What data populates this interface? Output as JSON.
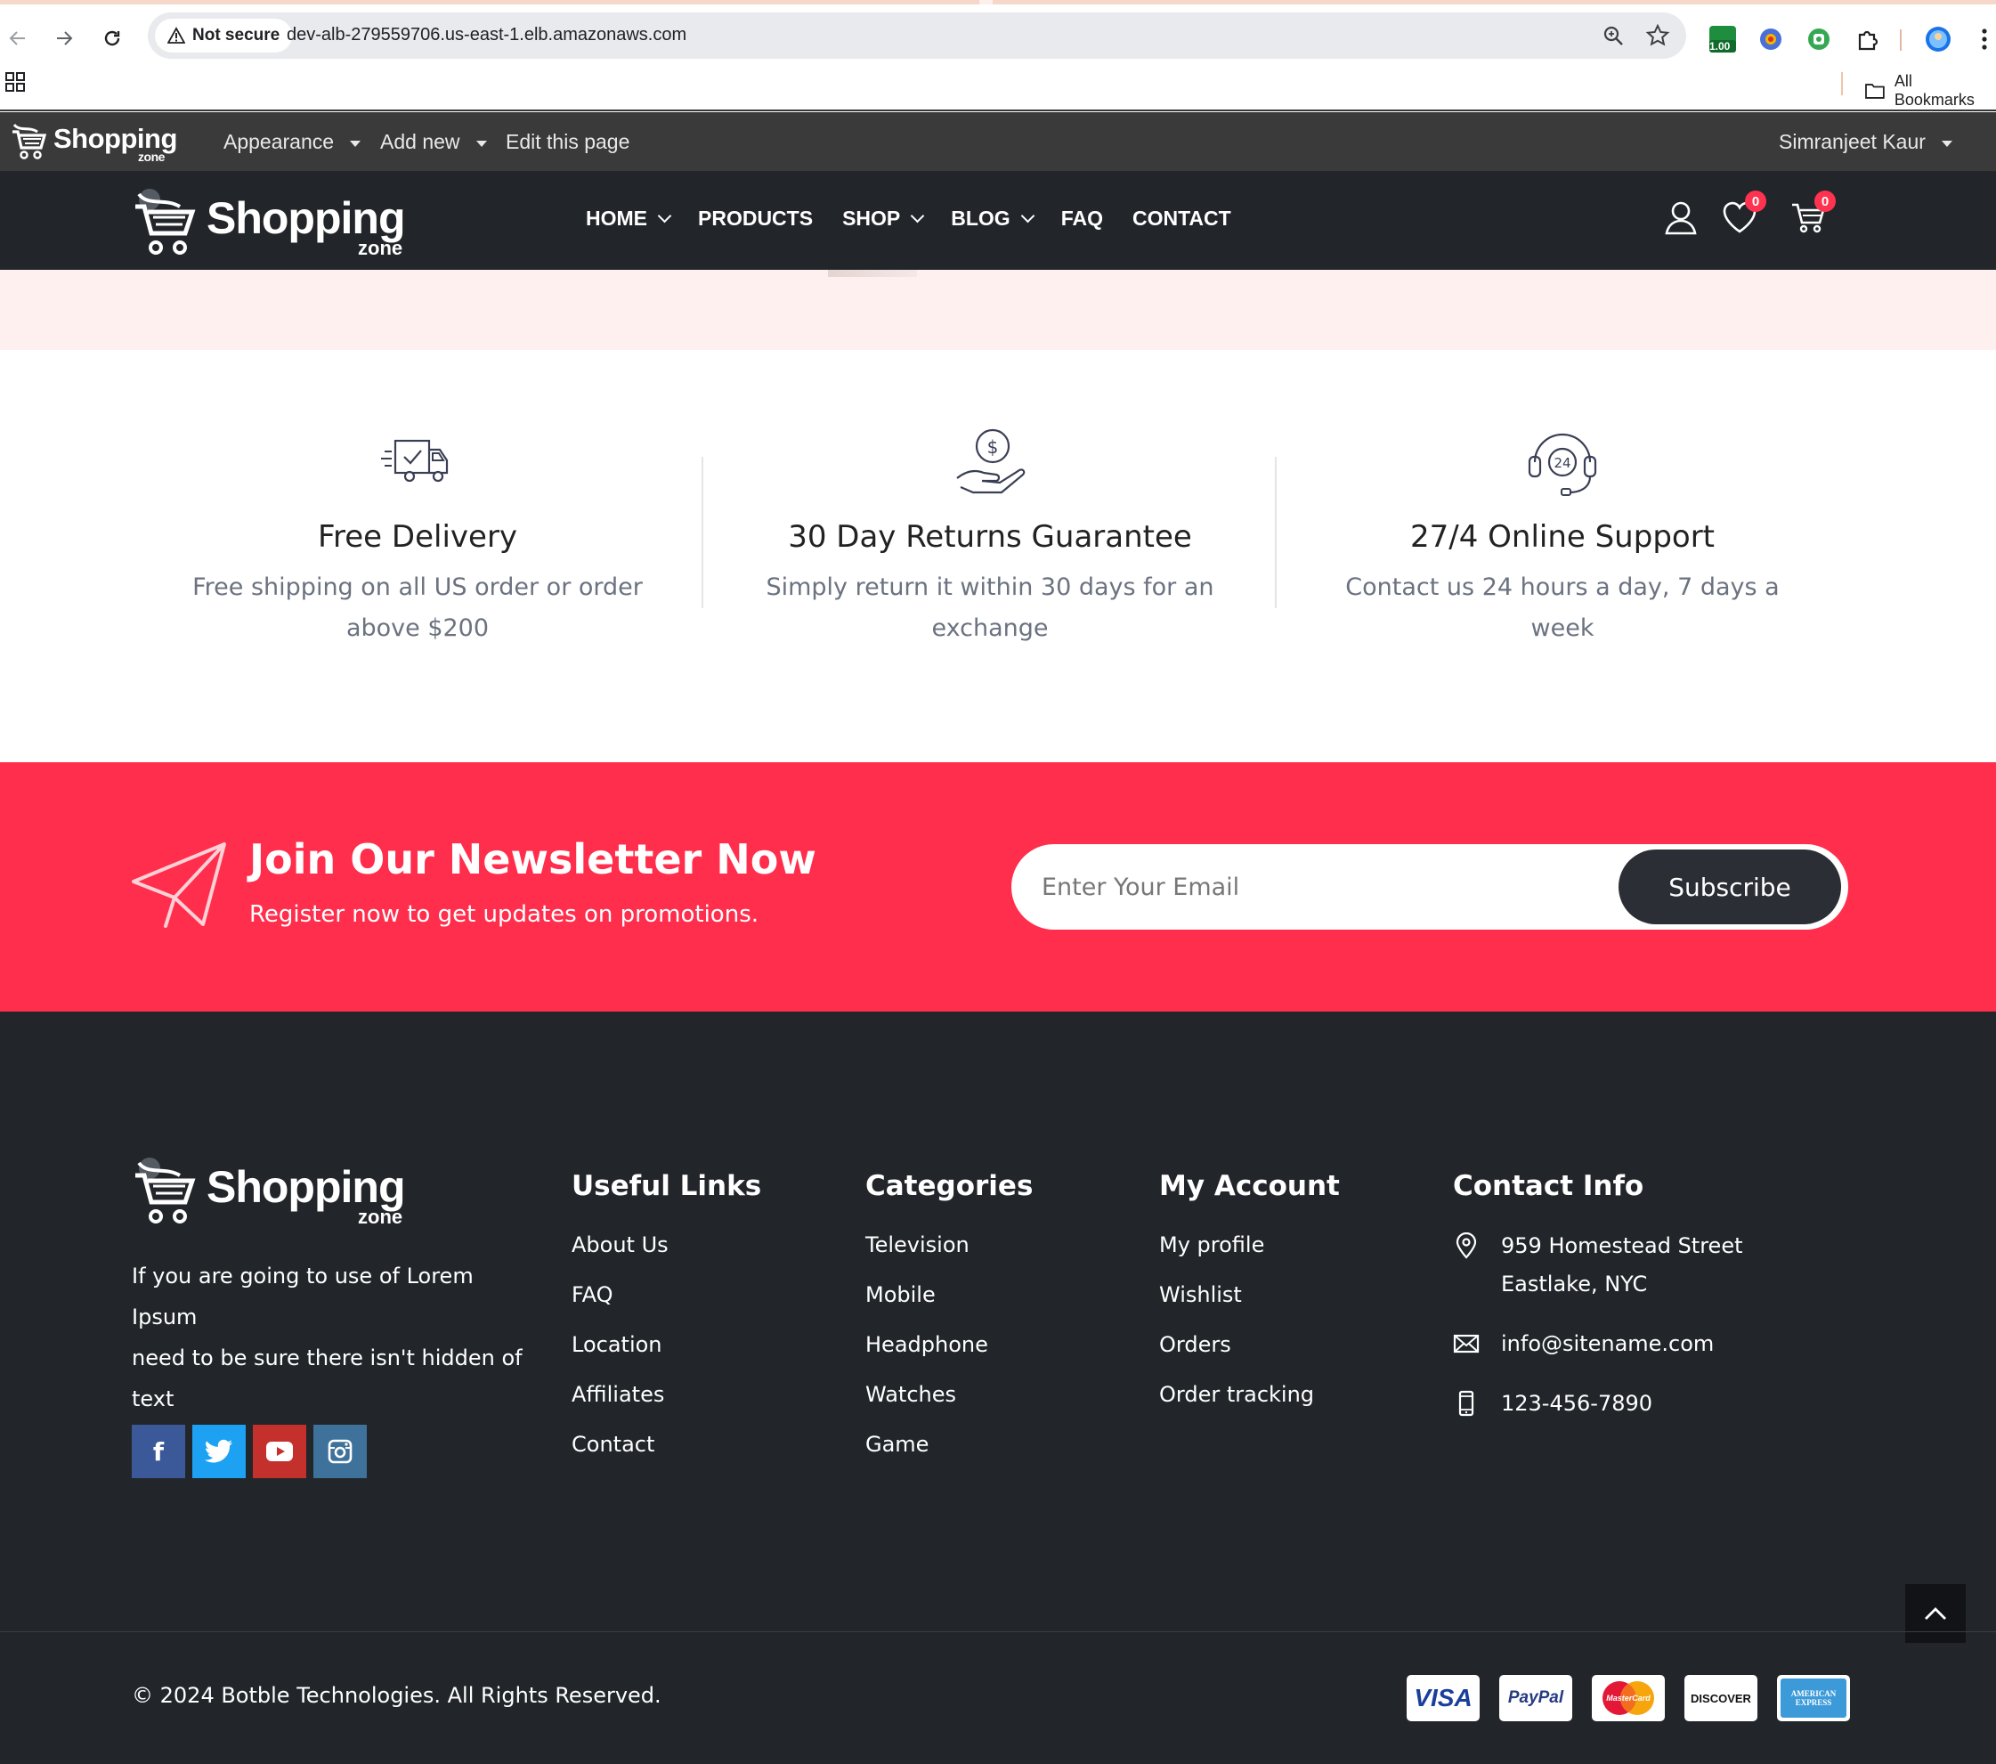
{
  "browser": {
    "security_label": "Not secure",
    "url": "dev-alb-279559706.us-east-1.elb.amazonaws.com",
    "extension_badge": "1.00",
    "bookmarks_label": "All Bookmarks"
  },
  "admin_bar": {
    "logo_text": "Shopping",
    "logo_sub": "zone",
    "menu": [
      {
        "label": "Appearance"
      },
      {
        "label": "Add new"
      },
      {
        "label": "Edit this page"
      }
    ],
    "user_name": "Simranjeet Kaur"
  },
  "header": {
    "logo_text": "Shopping",
    "logo_sub": "zone",
    "nav": [
      {
        "label": "HOME"
      },
      {
        "label": "PRODUCTS"
      },
      {
        "label": "SHOP"
      },
      {
        "label": "BLOG"
      },
      {
        "label": "FAQ"
      },
      {
        "label": "CONTACT"
      }
    ],
    "wishlist_count": "0",
    "cart_count": "0",
    "badge_color": "#ff3350"
  },
  "features": [
    {
      "icon": "delivery-truck-icon",
      "title": "Free Delivery",
      "desc_line1": "Free shipping on all US order or order",
      "desc_line2": "above $200"
    },
    {
      "icon": "money-back-icon",
      "title": "30 Day Returns Guarantee",
      "desc_line1": "Simply return it within 30 days for an",
      "desc_line2": "exchange"
    },
    {
      "icon": "support-headset-icon",
      "title": "27/4 Online Support",
      "desc_line1": "Contact us 24 hours a day, 7 days a",
      "desc_line2": "week"
    }
  ],
  "newsletter": {
    "title": "Join Our Newsletter Now",
    "subtitle": "Register now to get updates on promotions.",
    "placeholder": "Enter Your Email",
    "button": "Subscribe",
    "bg_color": "#ff2e4c"
  },
  "footer": {
    "logo_text": "Shopping",
    "logo_sub": "zone",
    "about_line1": "If you are going to use of Lorem Ipsum",
    "about_line2": "need to be sure there isn't hidden of",
    "about_line3": "text",
    "socials": [
      {
        "icon": "facebook-icon",
        "glyph": "f",
        "color": "#3b5998"
      },
      {
        "icon": "twitter-icon",
        "color": "#1da1f2"
      },
      {
        "icon": "youtube-icon",
        "color": "#c4302b"
      },
      {
        "icon": "instagram-icon",
        "color": "#3f729b"
      }
    ],
    "useful_links": {
      "title": "Useful Links",
      "items": [
        "About Us",
        "FAQ",
        "Location",
        "Affiliates",
        "Contact"
      ]
    },
    "categories": {
      "title": "Categories",
      "items": [
        "Television",
        "Mobile",
        "Headphone",
        "Watches",
        "Game"
      ]
    },
    "my_account": {
      "title": "My Account",
      "items": [
        "My profile",
        "Wishlist",
        "Orders",
        "Order tracking"
      ]
    },
    "contact": {
      "title": "Contact Info",
      "address_line1": "959 Homestead Street",
      "address_line2": "Eastlake, NYC",
      "email": "info@sitename.com",
      "phone": "123-456-7890"
    },
    "copyright": "© 2024 Botble Technologies. All Rights Reserved.",
    "payments": [
      {
        "name": "VISA"
      },
      {
        "name": "PayPal"
      },
      {
        "name": "MasterCard"
      },
      {
        "name": "DISCOVER"
      },
      {
        "name": "AMERICAN EXPRESS"
      }
    ]
  }
}
